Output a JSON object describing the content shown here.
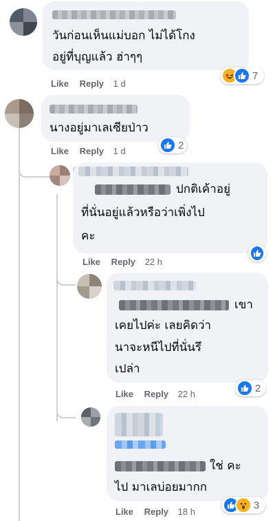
{
  "comments": [
    {
      "id": "c1",
      "lines": [
        "วันก่อนเห็นแม่บอก ไม่ได้โกง",
        "อยู่ที่บุญแล้ว ฮ่าๆๆ"
      ],
      "like": "Like",
      "reply": "Reply",
      "time": "1 d",
      "reaction_icons": [
        "haha-icon",
        "like-icon"
      ],
      "reaction_count": "7"
    },
    {
      "id": "c2",
      "lines": [
        "นางอยู่มาเลเซียป่าว"
      ],
      "like": "Like",
      "reply": "Reply",
      "time": "1 d",
      "reaction_icons": [
        "like-icon"
      ],
      "reaction_count": "2"
    },
    {
      "id": "c3",
      "lines": [
        "ปกติเค้าอยู่",
        "ที่นั่นอยู่แล้วหรือว่าเพิ่งไป",
        "คะ"
      ],
      "like": "Like",
      "reply": "Reply",
      "time": "22 h",
      "reaction_icons": [
        "like-icon"
      ],
      "reaction_count": ""
    },
    {
      "id": "c4",
      "lines": [
        "เขา",
        "เคยไปค่ะ เลยคิดว่า",
        "นาจะหนีไปที่นั่นรึ",
        "เปล่า"
      ],
      "like": "Like",
      "reply": "Reply",
      "time": "22 h",
      "reaction_icons": [
        "like-icon"
      ],
      "reaction_count": "2"
    },
    {
      "id": "c5",
      "lines": [
        "ใช่ คะ",
        "ไป มาเลบ่อยมากก"
      ],
      "like": "Like",
      "reply": "Reply",
      "time": "18 h",
      "reaction_icons": [
        "like-icon",
        "wow-icon"
      ],
      "reaction_count": "3"
    }
  ],
  "colors": {
    "bubble": "#f0f2f5",
    "action_text": "#65676b",
    "like_blue": "#1877f2",
    "emoji_yellow": "#f7b125",
    "thread_line": "#ced0d4"
  }
}
